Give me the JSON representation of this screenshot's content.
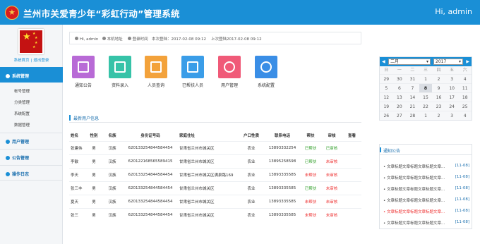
{
  "header": {
    "title": "兰州市关爱青少年“彩虹行动”管理系统",
    "greeting": "Hi, admin"
  },
  "sidebar": {
    "home_link": "系统首页",
    "logout_link": "退出登录",
    "sections": [
      {
        "label": "系统管理",
        "items": [
          "帐号管理",
          "分类管理",
          "系统配置",
          "数据管理"
        ]
      },
      {
        "label": "用户管理"
      },
      {
        "label": "公告管理"
      },
      {
        "label": "操作日志"
      }
    ]
  },
  "infobar": {
    "user": "Hi, admin",
    "location": "本机地址",
    "login": "登录时间",
    "this_login": "本次登陆：2017-02-08 09:12",
    "last_login": "上次登陆2017-02-08 09:12"
  },
  "tiles": [
    {
      "label": "通知公告",
      "color": "#b86ad6",
      "icon": "chat-icon"
    },
    {
      "label": "资料录入",
      "color": "#36c3a8",
      "icon": "keyboard-icon"
    },
    {
      "label": "人员查询",
      "color": "#f3a23b",
      "icon": "folder-icon"
    },
    {
      "label": "已帮扶人员",
      "color": "#3a9de8",
      "icon": "handshake-icon"
    },
    {
      "label": "用户管理",
      "color": "#f05a78",
      "icon": "user-icon"
    },
    {
      "label": "系统配置",
      "color": "#3a8ee6",
      "icon": "gear-icon"
    }
  ],
  "table": {
    "title": "最新用户信息",
    "columns": [
      "姓名",
      "性别",
      "名族",
      "身份证号码",
      "家庭住址",
      "户口性质",
      "联系电话",
      "帮扶",
      "审核",
      "查看"
    ],
    "rows": [
      [
        "张建伟",
        "男",
        "汉族",
        "620133254844584454",
        "甘肃省兰州市城关区",
        "农业",
        "13893332254",
        "已帮扶",
        "已审核",
        ""
      ],
      [
        "李敏",
        "男",
        "汉族",
        "620122168565589415",
        "甘肃省兰州市城关区",
        "农业",
        "13895258598",
        "已帮扶",
        "未审核",
        ""
      ],
      [
        "李天",
        "男",
        "汉族",
        "620133254844584454",
        "甘肃省兰州市城关区满泉路169",
        "农业",
        "13893335585",
        "未帮扶",
        "未审核",
        ""
      ],
      [
        "张三丰",
        "男",
        "汉族",
        "620133254844584454",
        "甘肃省兰州市城关区",
        "农业",
        "13893335585",
        "已帮扶",
        "未审核",
        ""
      ],
      [
        "夏天",
        "男",
        "汉族",
        "620133254844584454",
        "甘肃省兰州市城关区",
        "农业",
        "13893335585",
        "未帮扶",
        "未审核",
        ""
      ],
      [
        "张三",
        "男",
        "汉族",
        "620133254844584454",
        "甘肃省兰州市城关区",
        "农业",
        "13893335585",
        "未帮扶",
        "未审核",
        ""
      ]
    ]
  },
  "calendar": {
    "month": "二月",
    "year": "2017",
    "weekdays": [
      "日",
      "一",
      "二",
      "三",
      "四",
      "五",
      "六"
    ],
    "days": [
      "29",
      "30",
      "31",
      "1",
      "2",
      "3",
      "4",
      "5",
      "6",
      "7",
      "8",
      "9",
      "10",
      "11",
      "12",
      "13",
      "14",
      "15",
      "16",
      "17",
      "18",
      "19",
      "20",
      "21",
      "22",
      "23",
      "24",
      "25",
      "26",
      "27",
      "28",
      "1",
      "2",
      "3",
      "4"
    ],
    "today": "8"
  },
  "notices": {
    "title": "通知公告",
    "items": [
      {
        "text": "文章标题文章标题文章标题文章...",
        "date": "[11-08]"
      },
      {
        "text": "文章标题文章标题文章标题文章...",
        "date": "[11-08]"
      },
      {
        "text": "文章标题文章标题文章标题文章...",
        "date": "[11-08]"
      },
      {
        "text": "文章标题文章标题文章标题文章...",
        "date": "[11-08]"
      },
      {
        "text": "文章标题文章标题文章标题文章...",
        "date": "[11-08]"
      },
      {
        "text": "文章标题文章标题文章标题文章...",
        "date": "[11-08]"
      }
    ]
  }
}
